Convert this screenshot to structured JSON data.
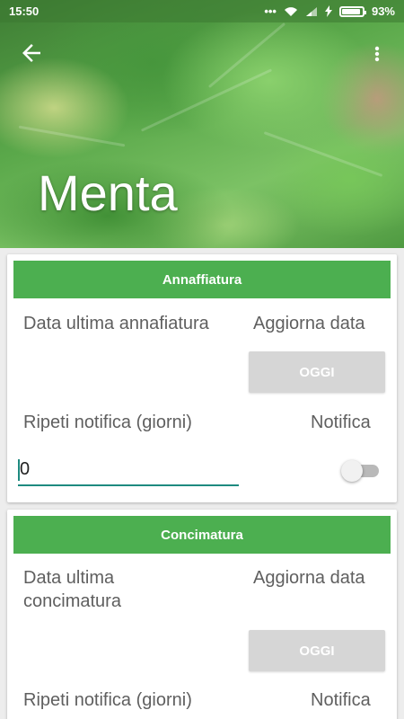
{
  "status_bar": {
    "time": "15:50",
    "battery": "93%",
    "battery_level": 0.93
  },
  "header": {
    "title": "Menta",
    "back_icon": "arrow-back-icon",
    "menu_icon": "more-vert-icon"
  },
  "sections": [
    {
      "header": "Annaffiatura",
      "last_date_label": "Data ultima annafiatura",
      "update_label": "Aggiorna data",
      "today_button": "OGGI",
      "repeat_label": "Ripeti notifica (giorni)",
      "notify_label": "Notifica",
      "days_value": "0",
      "notify_on": false
    },
    {
      "header": "Concimatura",
      "last_date_label": "Data ultima concimatura",
      "update_label": "Aggiorna data",
      "today_button": "OGGI",
      "repeat_label": "Ripeti notifica (giorni)",
      "notify_label": "Notifica"
    }
  ],
  "colors": {
    "accent": "#4caf50",
    "input_underline": "#1e8a80",
    "button_disabled": "#d6d6d6"
  }
}
